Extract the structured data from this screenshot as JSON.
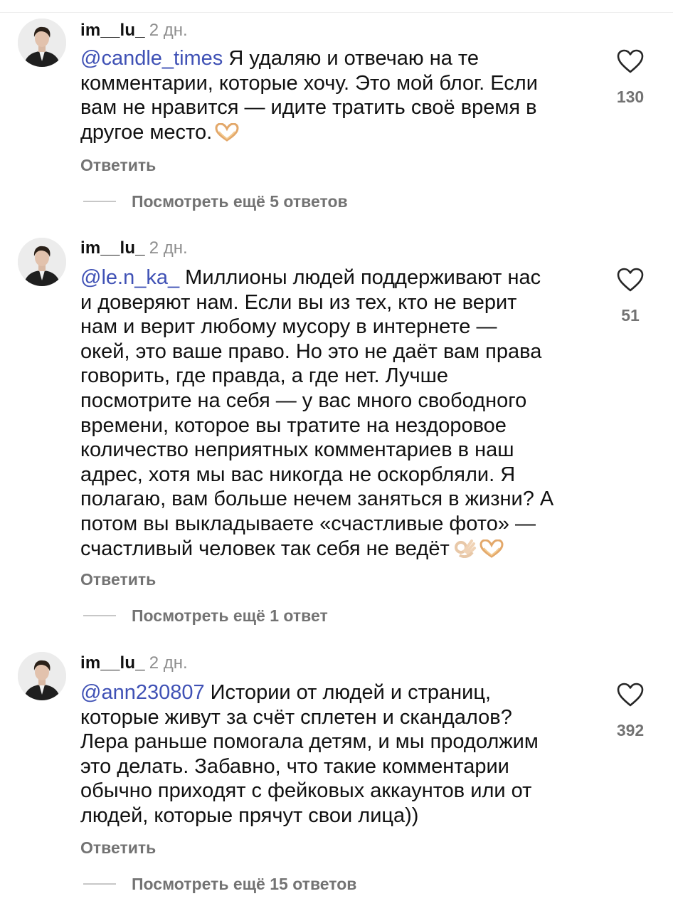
{
  "comments": [
    {
      "username": "im__lu_",
      "time": "2 дн.",
      "mention": "@candle_times",
      "lines": [
        "Я удаляю и отвечаю на те",
        "комментарии, которые хочу. Это мой блог. Если",
        "вам не нравится — идите тратить своё время в",
        "другое место."
      ],
      "emojis": [
        "heart-hands"
      ],
      "reply_label": "Ответить",
      "likes": "130",
      "view_more": "Посмотреть ещё 5 ответов"
    },
    {
      "username": "im__lu_",
      "time": "2 дн.",
      "mention": "@le.n_ka_",
      "lines": [
        "Миллионы людей поддерживают нас",
        "и доверяют нам. Если вы из тех, кто не верит",
        "нам и верит любому мусору в интернете —",
        "окей, это ваше право. Но это не даёт вам права",
        "говорить, где правда, а где нет. Лучше",
        "посмотрите на себя — у вас много свободного",
        "времени, которое вы тратите на нездоровое",
        "количество неприятных комментариев в наш",
        "адрес, хотя мы вас никогда не оскорбляли. Я",
        "полагаю, вам больше нечем заняться в жизни? А",
        "потом вы выкладываете «счастливые фото» —",
        "счастливый человек так себя не ведёт"
      ],
      "emojis": [
        "ok-hand",
        "heart-hands"
      ],
      "reply_label": "Ответить",
      "likes": "51",
      "view_more": "Посмотреть ещё 1 ответ"
    },
    {
      "username": "im__lu_",
      "time": "2 дн.",
      "mention": "@ann230807",
      "lines": [
        "Истории от людей и страниц,",
        "которые живут за счёт сплетен и скандалов?",
        "Лера раньше помогала детям, и мы продолжим",
        "это делать. Забавно, что такие комментарии",
        "обычно приходят с фейковых аккаунтов или от",
        "людей, которые прячут свои лица))"
      ],
      "emojis": [],
      "reply_label": "Ответить",
      "likes": "392",
      "view_more": "Посмотреть ещё 15 ответов"
    }
  ],
  "colors": {
    "mention": "#3f51b5",
    "secondary_text": "#737373",
    "time_text": "#8e8e8e",
    "heart_outline": "#262626"
  },
  "icons": {
    "like": "heart-outline-icon",
    "avatar": "profile-avatar"
  }
}
